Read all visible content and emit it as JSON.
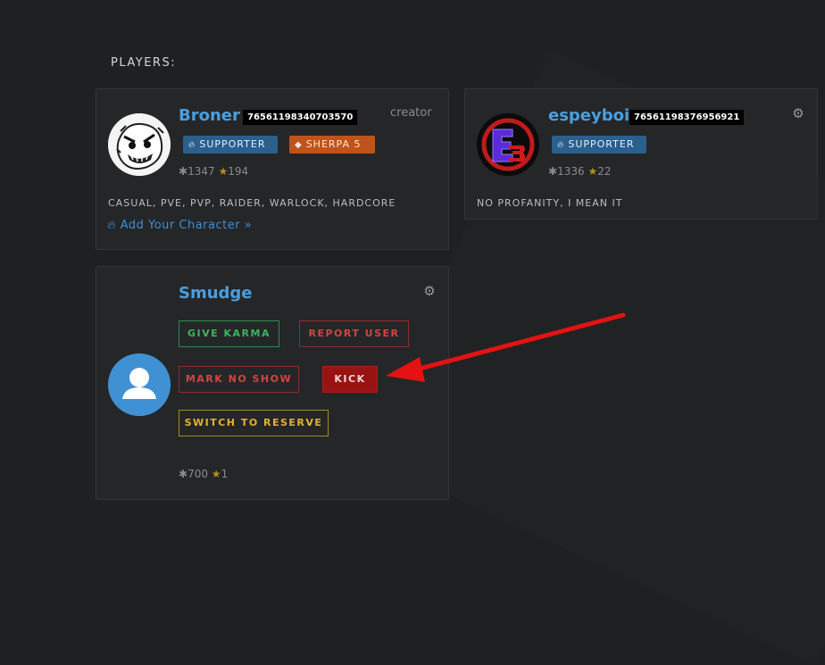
{
  "section": {
    "title": "PLAYERS:"
  },
  "players": [
    {
      "name": "Broner",
      "steam_id": "76561198340703570",
      "tag": "creator",
      "badges": [
        "SUPPORTER",
        "SHERPA 5"
      ],
      "karma": "1347",
      "stars": "194",
      "tags": "CASUAL, PVE, PVP, RAIDER, WARLOCK, HARDCORE",
      "add_character": "Add Your Character »"
    },
    {
      "name": "espeyboi",
      "steam_id": "76561198376956921",
      "badges": [
        "SUPPORTER"
      ],
      "karma": "1336",
      "stars": "22",
      "tags": "NO PROFANITY, I MEAN IT"
    },
    {
      "name": "Smudge",
      "karma": "700",
      "stars": "1",
      "actions": {
        "give_karma": "GIVE KARMA",
        "report_user": "REPORT USER",
        "mark_no_show": "MARK NO SHOW",
        "kick": "KICK",
        "switch_to_reserve": "SWITCH TO RESERVE"
      }
    }
  ],
  "colors": {
    "name": "#4a9fe0",
    "supporter": "#2a5f8e",
    "sherpa": "#c0531a",
    "kick": "#991313",
    "arrow": "#e41212"
  },
  "icons": [
    "karma-icon",
    "star-icon",
    "flame-icon",
    "shield-icon",
    "gear-icon",
    "default-avatar-icon"
  ]
}
